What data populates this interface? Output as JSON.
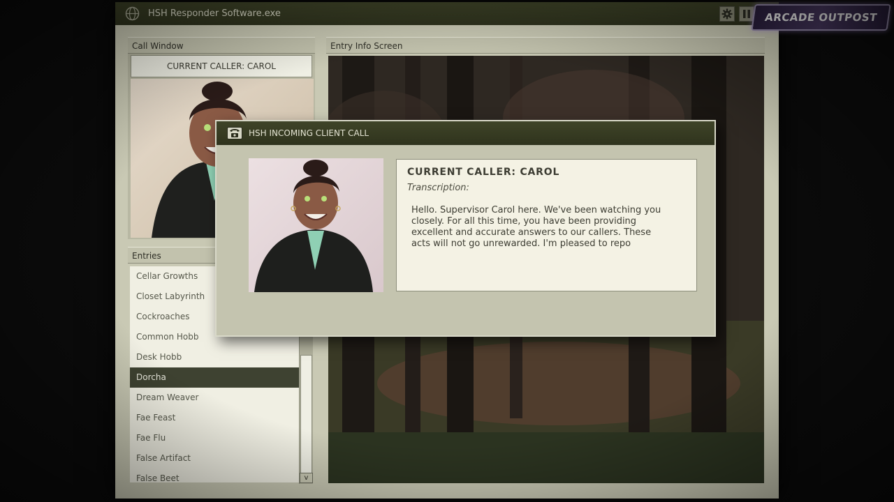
{
  "window": {
    "title": "HSH Responder Software.exe",
    "icons": [
      "globe-icon",
      "gear-icon",
      "pause-icon"
    ]
  },
  "overlay_logo": {
    "text": "ARCADE OUTPOST"
  },
  "call_window": {
    "header": "Call Window",
    "current_caller": "CURRENT CALLER: CAROL"
  },
  "entry_info": {
    "header": "Entry Info Screen"
  },
  "entries": {
    "header": "Entries",
    "items": [
      {
        "label": "Cellar Growths",
        "selected": false
      },
      {
        "label": "Closet Labyrinth",
        "selected": false
      },
      {
        "label": "Cockroaches",
        "selected": false
      },
      {
        "label": "Common Hobb",
        "selected": false
      },
      {
        "label": "Desk Hobb",
        "selected": false
      },
      {
        "label": "Dorcha",
        "selected": true
      },
      {
        "label": "Dream Weaver",
        "selected": false
      },
      {
        "label": "Fae Feast",
        "selected": false
      },
      {
        "label": "Fae Flu",
        "selected": false
      },
      {
        "label": "False Artifact",
        "selected": false
      },
      {
        "label": "False Beet",
        "selected": false
      }
    ],
    "scroll_down_glyph": "v"
  },
  "dialog": {
    "title": "HSH INCOMING CLIENT CALL",
    "icon": "telephone-icon",
    "caller_heading": "CURRENT CALLER: CAROL",
    "transcription_label": "Transcription:",
    "transcript": "Hello. Supervisor Carol here. We've been watching you closely. For all this time, you have been providing excellent and accurate answers to our callers. These acts will not go unrewarded. I'm pleased to repo"
  },
  "colors": {
    "titlebar": "#2e321d",
    "panel": "#c9c9b4",
    "selected_entry": "#3e4231",
    "list_bg": "#f0efe3"
  }
}
